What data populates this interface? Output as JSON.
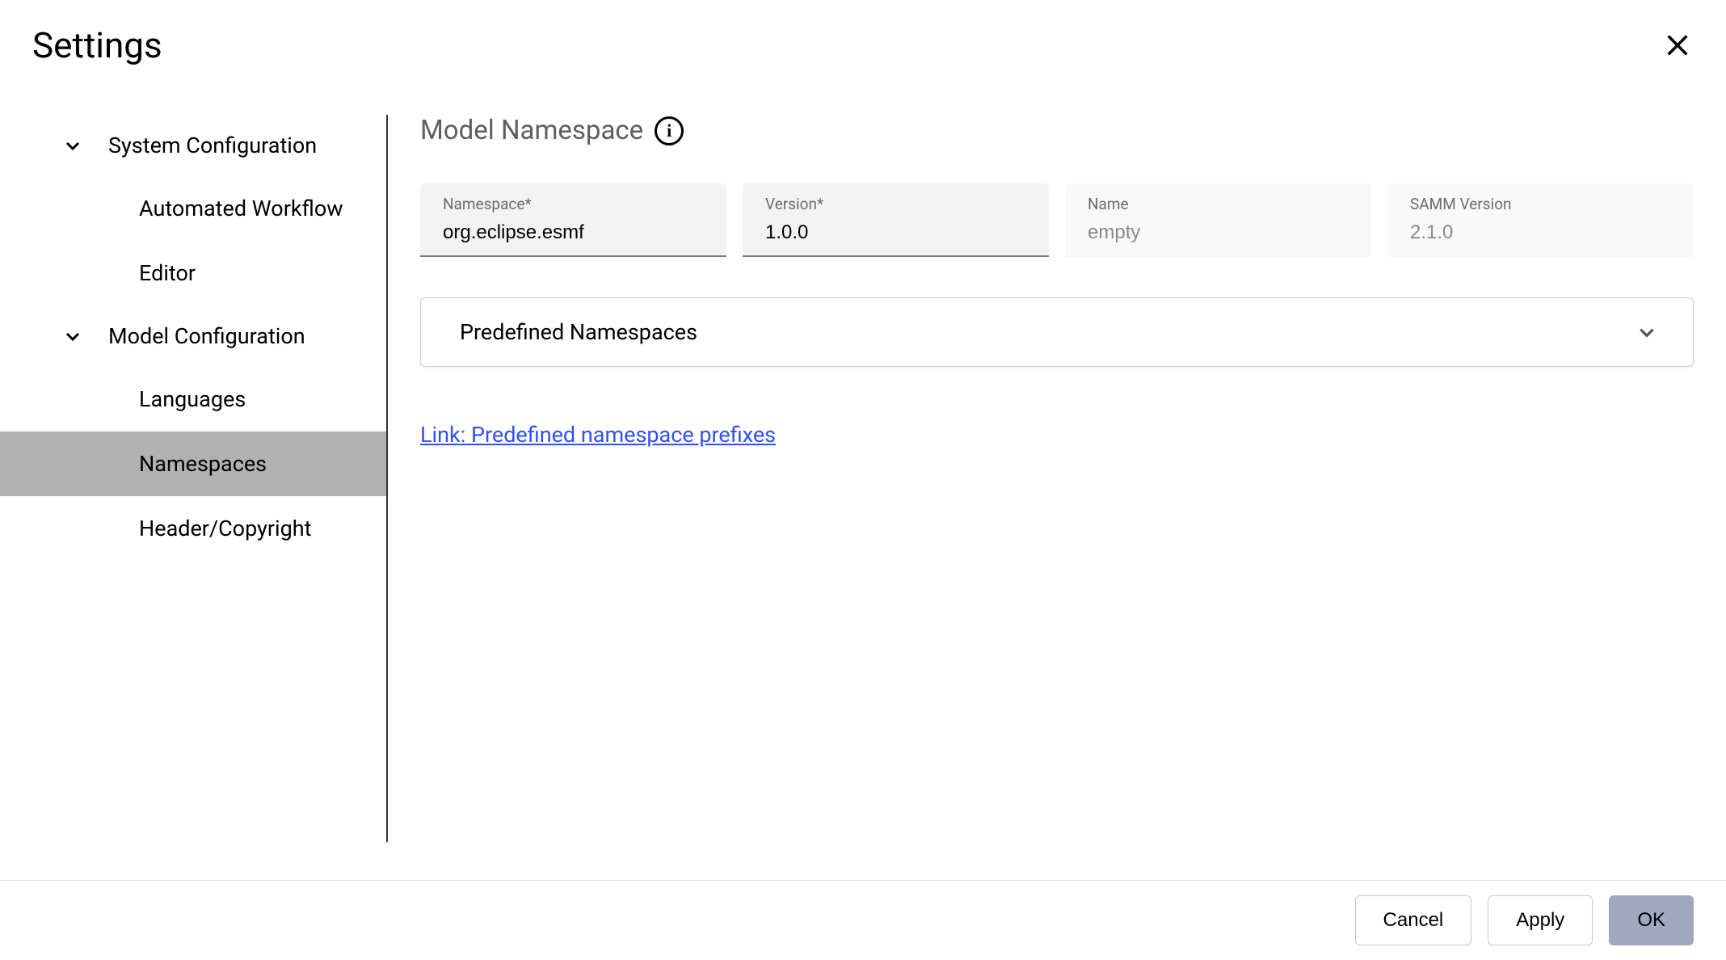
{
  "dialog": {
    "title": "Settings"
  },
  "sidebar": {
    "groups": [
      {
        "label": "System Configuration",
        "items": [
          {
            "label": "Automated Workflow"
          },
          {
            "label": "Editor"
          }
        ]
      },
      {
        "label": "Model Configuration",
        "items": [
          {
            "label": "Languages"
          },
          {
            "label": "Namespaces",
            "active": true
          },
          {
            "label": "Header/Copyright"
          }
        ]
      }
    ]
  },
  "content": {
    "title": "Model Namespace",
    "fields": {
      "namespace": {
        "label": "Namespace*",
        "value": "org.eclipse.esmf"
      },
      "version": {
        "label": "Version*",
        "value": "1.0.0"
      },
      "name": {
        "label": "Name",
        "value": "empty"
      },
      "samm_version": {
        "label": "SAMM Version",
        "value": "2.1.0"
      }
    },
    "accordion": {
      "title": "Predefined Namespaces"
    },
    "link": {
      "text": "Link: Predefined namespace prefixes"
    }
  },
  "footer": {
    "cancel": "Cancel",
    "apply": "Apply",
    "ok": "OK"
  }
}
